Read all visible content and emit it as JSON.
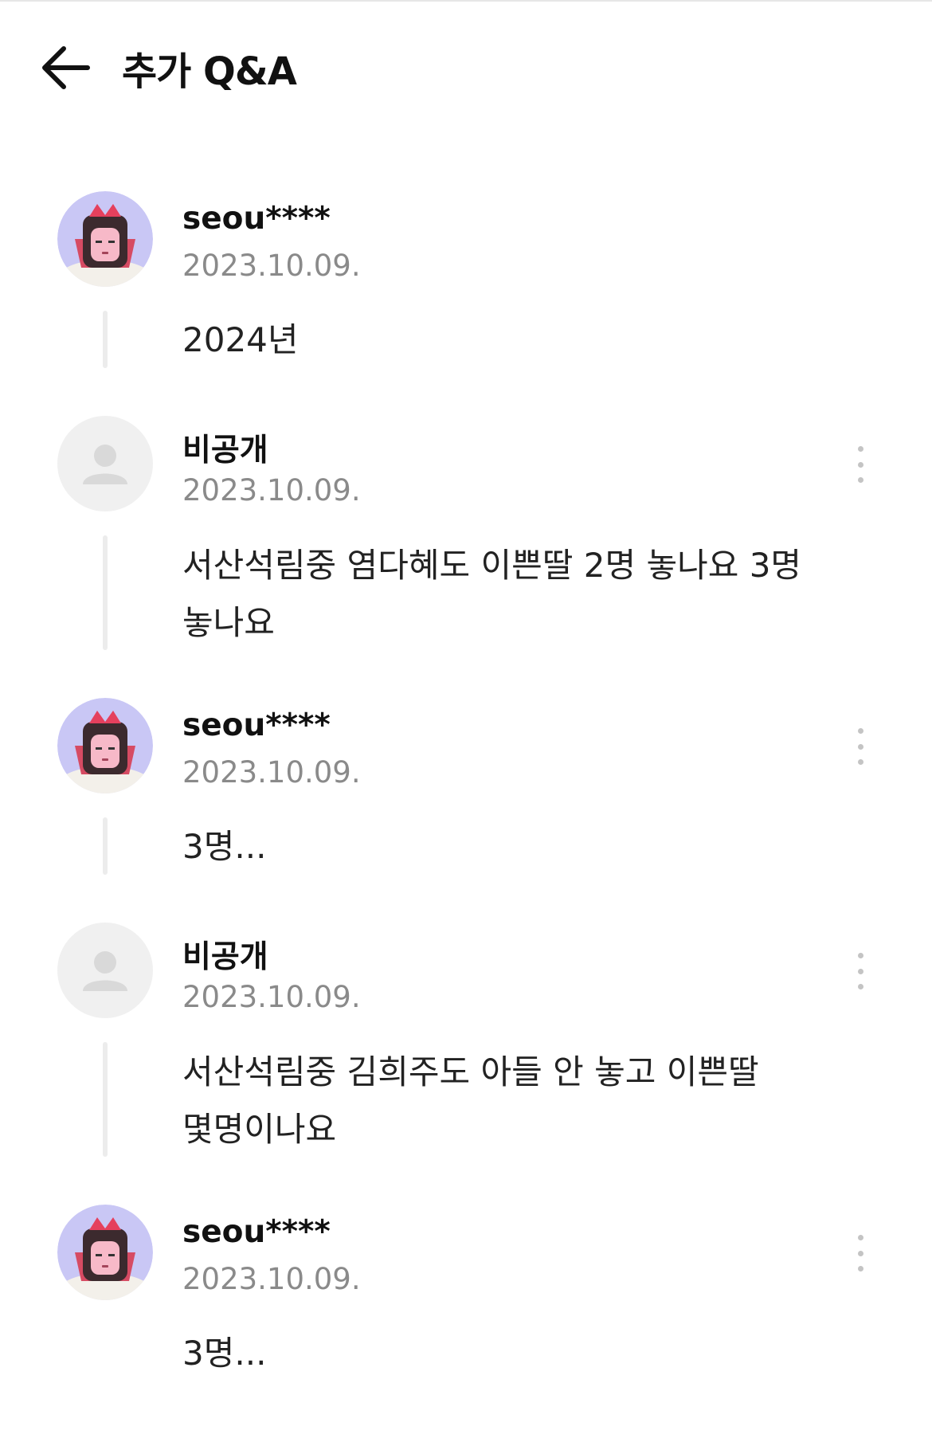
{
  "header": {
    "title": "추가 Q&A",
    "back_icon": "arrow-left-icon"
  },
  "colors": {
    "text": "#111111",
    "date": "#8a8a8a",
    "thread_line": "#ececec",
    "more_dots": "#c4c4c4"
  },
  "comments": [
    {
      "author": "seou****",
      "date": "2023.10.09.",
      "text": "2024년",
      "avatar": "character-avatar",
      "has_more": false
    },
    {
      "author": "비공개",
      "date": "2023.10.09.",
      "text": "서산석림중 염다혜도 이쁜딸 2명 놓나요 3명 놓나요",
      "avatar": "default-user-icon",
      "has_more": true
    },
    {
      "author": "seou****",
      "date": "2023.10.09.",
      "text": "3명...",
      "avatar": "character-avatar",
      "has_more": true
    },
    {
      "author": "비공개",
      "date": "2023.10.09.",
      "text": "서산석림중 김희주도 아들 안 놓고 이쁜딸 몇명이나요",
      "avatar": "default-user-icon",
      "has_more": true
    },
    {
      "author": "seou****",
      "date": "2023.10.09.",
      "text": "3명...",
      "avatar": "character-avatar",
      "has_more": true
    }
  ]
}
